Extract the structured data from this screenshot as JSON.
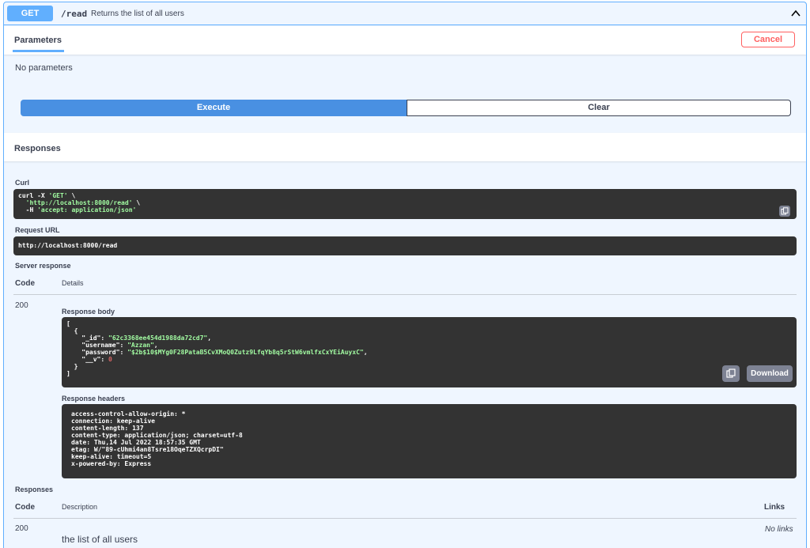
{
  "operation": {
    "method": "GET",
    "path": "/read",
    "summary": "Returns the list of all users"
  },
  "parameters": {
    "tab_label": "Parameters",
    "cancel_label": "Cancel",
    "empty_text": "No parameters"
  },
  "actions": {
    "execute_label": "Execute",
    "clear_label": "Clear"
  },
  "responses_section": {
    "title": "Responses"
  },
  "curl": {
    "label": "Curl",
    "lines": [
      {
        "pre": "curl -X ",
        "str": "'GET'",
        "post": " \\"
      },
      {
        "pre": "  ",
        "str": "'http://localhost:8000/read'",
        "post": " \\"
      },
      {
        "pre": "  -H ",
        "str": "'accept: application/json'",
        "post": ""
      }
    ]
  },
  "request_url": {
    "label": "Request URL",
    "value": "http://localhost:8000/read"
  },
  "server_response": {
    "label": "Server response",
    "code_header": "Code",
    "details_header": "Details",
    "code": "200",
    "body_label": "Response body",
    "body": {
      "id_key": "\"_id\"",
      "id_val": "\"62c3368ee454d1988da72cd7\"",
      "username_key": "\"username\"",
      "username_val": "\"Azzan\"",
      "password_key": "\"password\"",
      "password_val": "\"$2b$10$MYg0F28PataB5CvXMoQ0Zutz9LfqYb8q5rStW6vmlfxCxYEiAuyxC\"",
      "v_key": "\"__v\"",
      "v_val": "0"
    },
    "download_label": "Download",
    "headers_label": "Response headers",
    "headers": [
      "access-control-allow-origin: *",
      "connection: keep-alive",
      "content-length: 137",
      "content-type: application/json; charset=utf-8",
      "date: Thu,14 Jul 2022 18:57:35 GMT",
      "etag: W/\"89-cUhmi4an8Tsre18OqeTZXQcrpDI\"",
      "keep-alive: timeout=5",
      "x-powered-by: Express"
    ]
  },
  "responses_table": {
    "label": "Responses",
    "code_header": "Code",
    "description_header": "Description",
    "links_header": "Links",
    "rows": [
      {
        "code": "200",
        "description": "the list of all users",
        "links": "No links"
      }
    ]
  },
  "colors": {
    "get_accent": "#61affe",
    "execute": "#4990e2",
    "cancel": "#ff6060",
    "code_bg": "#333333",
    "string": "#a2fca2",
    "number": "#d36363"
  },
  "icons": [
    "chevron-up-icon",
    "copy-icon"
  ]
}
